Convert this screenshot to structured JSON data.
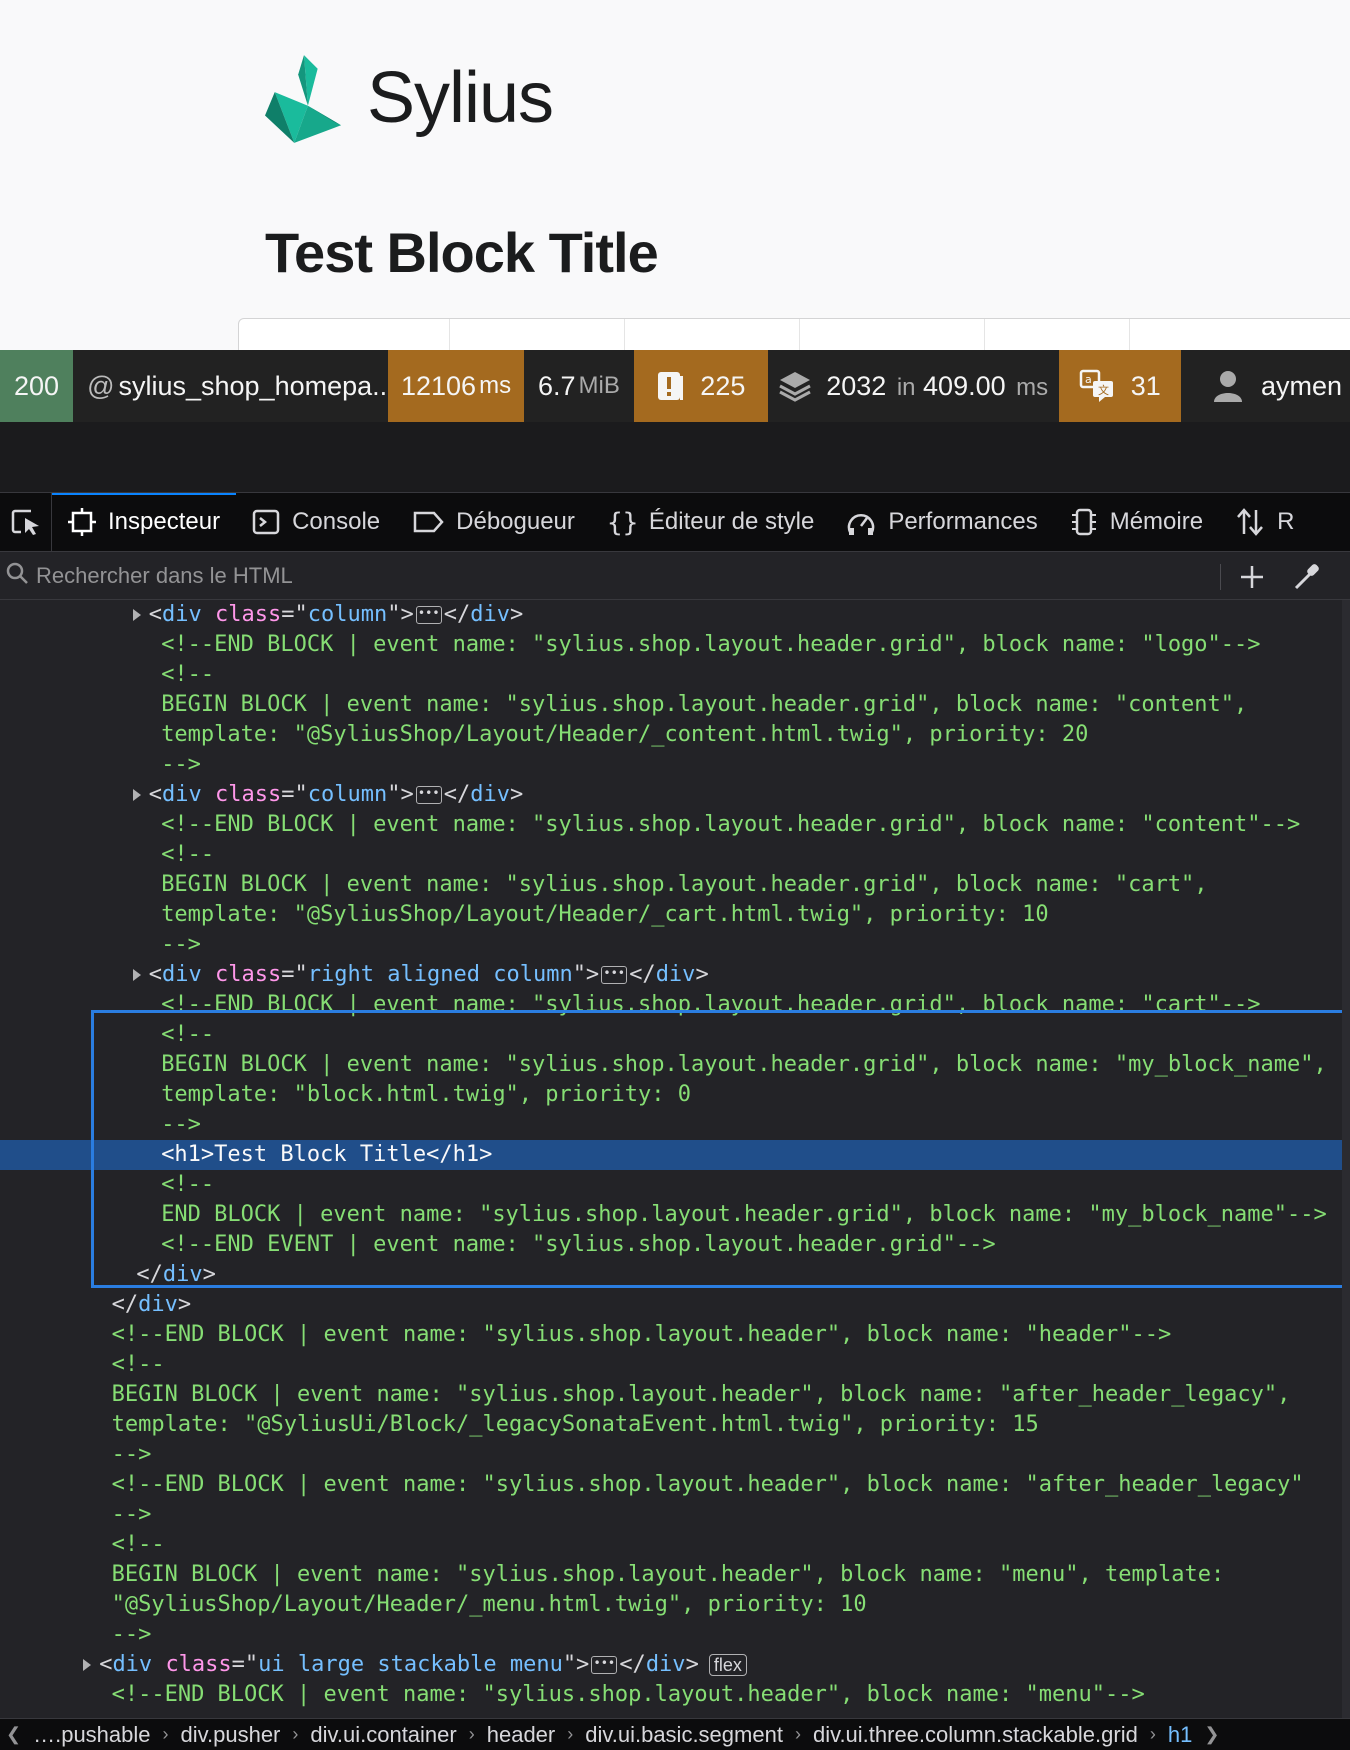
{
  "preview": {
    "logo_text": "Sylius",
    "heading": "Test Block Title"
  },
  "toolbar": {
    "status": "200",
    "route_at": "@",
    "route": "sylius_shop_homepa...",
    "time_value": "12106",
    "time_unit": "ms",
    "memory_value": "6.7",
    "memory_unit": "MiB",
    "forms_count": "225",
    "db_queries": "2032",
    "db_in": "in",
    "db_time": "409.00",
    "db_time_unit": "ms",
    "translations_count": "31",
    "user": "aymen"
  },
  "devtools": {
    "tabs": [
      {
        "label": "Inspecteur",
        "icon": "inspector-icon",
        "active": true
      },
      {
        "label": "Console",
        "icon": "console-icon"
      },
      {
        "label": "Débogueur",
        "icon": "debugger-icon"
      },
      {
        "label": "Éditeur de style",
        "icon": "style-editor-icon"
      },
      {
        "label": "Performances",
        "icon": "performance-icon"
      },
      {
        "label": "Mémoire",
        "icon": "memory-icon"
      },
      {
        "label": "R",
        "icon": "network-icon"
      }
    ],
    "search_placeholder": "Rechercher dans le HTML"
  },
  "markup": {
    "lines": [
      {
        "type": "el",
        "indent": 12,
        "expand": true,
        "tag": "div",
        "attrs": [
          [
            "class",
            "column"
          ]
        ],
        "collapsed": true
      },
      {
        "type": "c",
        "indent": 13,
        "text": "<!--END BLOCK | event name: \"sylius.shop.layout.header.grid\", block name: \"logo\"-->"
      },
      {
        "type": "c",
        "indent": 13,
        "text": "<!--"
      },
      {
        "type": "c",
        "indent": 13,
        "text": "BEGIN BLOCK | event name: \"sylius.shop.layout.header.grid\", block name: \"content\","
      },
      {
        "type": "c",
        "indent": 13,
        "text": "template: \"@SyliusShop/Layout/Header/_content.html.twig\", priority: 20"
      },
      {
        "type": "c",
        "indent": 13,
        "text": "-->"
      },
      {
        "type": "el",
        "indent": 12,
        "expand": true,
        "tag": "div",
        "attrs": [
          [
            "class",
            "column"
          ]
        ],
        "collapsed": true
      },
      {
        "type": "c",
        "indent": 13,
        "text": "<!--END BLOCK | event name: \"sylius.shop.layout.header.grid\", block name: \"content\"-->"
      },
      {
        "type": "c",
        "indent": 13,
        "text": "<!--"
      },
      {
        "type": "c",
        "indent": 13,
        "text": "BEGIN BLOCK | event name: \"sylius.shop.layout.header.grid\", block name: \"cart\","
      },
      {
        "type": "c",
        "indent": 13,
        "text": "template: \"@SyliusShop/Layout/Header/_cart.html.twig\", priority: 10"
      },
      {
        "type": "c",
        "indent": 13,
        "text": "-->"
      },
      {
        "type": "el",
        "indent": 12,
        "expand": true,
        "tag": "div",
        "attrs": [
          [
            "class",
            "right aligned column"
          ]
        ],
        "collapsed": true
      },
      {
        "type": "c",
        "indent": 13,
        "text": "<!--END BLOCK | event name: \"sylius.shop.layout.header.grid\", block name: \"cart\"-->"
      },
      {
        "type": "c",
        "indent": 13,
        "text": "<!--"
      },
      {
        "type": "c",
        "indent": 13,
        "text": "BEGIN BLOCK | event name: \"sylius.shop.layout.header.grid\", block name: \"my_block_name\","
      },
      {
        "type": "c",
        "indent": 13,
        "text": "template: \"block.html.twig\", priority: 0"
      },
      {
        "type": "c",
        "indent": 13,
        "text": "-->"
      },
      {
        "type": "sel",
        "indent": 13,
        "open": "<h1>",
        "text": "Test Block Title",
        "close": "</h1>"
      },
      {
        "type": "c",
        "indent": 13,
        "text": "<!--"
      },
      {
        "type": "c",
        "indent": 13,
        "text": "END BLOCK | event name: \"sylius.shop.layout.header.grid\", block name: \"my_block_name\"-->"
      },
      {
        "type": "c",
        "indent": 13,
        "text": "<!--END EVENT | event name: \"sylius.shop.layout.header.grid\"-->"
      },
      {
        "type": "close",
        "indent": 11,
        "tag": "div"
      },
      {
        "type": "close",
        "indent": 9,
        "tag": "div"
      },
      {
        "type": "c",
        "indent": 9,
        "text": "<!--END BLOCK | event name: \"sylius.shop.layout.header\", block name: \"header\"-->"
      },
      {
        "type": "c",
        "indent": 9,
        "text": "<!--"
      },
      {
        "type": "c",
        "indent": 9,
        "text": "BEGIN BLOCK | event name: \"sylius.shop.layout.header\", block name: \"after_header_legacy\","
      },
      {
        "type": "c",
        "indent": 9,
        "text": "template: \"@SyliusUi/Block/_legacySonataEvent.html.twig\", priority: 15"
      },
      {
        "type": "c",
        "indent": 9,
        "text": "-->"
      },
      {
        "type": "c",
        "indent": 9,
        "text": "<!--END BLOCK | event name: \"sylius.shop.layout.header\", block name: \"after_header_legacy\""
      },
      {
        "type": "c",
        "indent": 9,
        "text": "-->"
      },
      {
        "type": "c",
        "indent": 9,
        "text": "<!--"
      },
      {
        "type": "c",
        "indent": 9,
        "text": "BEGIN BLOCK | event name: \"sylius.shop.layout.header\", block name: \"menu\", template:"
      },
      {
        "type": "c",
        "indent": 9,
        "text": "\"@SyliusShop/Layout/Header/_menu.html.twig\", priority: 10"
      },
      {
        "type": "c",
        "indent": 9,
        "text": "-->"
      },
      {
        "type": "el",
        "indent": 8,
        "expand": true,
        "tag": "div",
        "attrs": [
          [
            "class",
            "ui large stackable menu"
          ]
        ],
        "collapsed": true,
        "badge": "flex"
      },
      {
        "type": "c",
        "indent": 9,
        "text": "<!--END BLOCK | event name: \"sylius.shop.layout.header\", block name: \"menu\"-->"
      }
    ]
  },
  "breadcrumbs": [
    "….pushable",
    "div.pusher",
    "div.ui.container",
    "header",
    "div.ui.basic.segment",
    "div.ui.three.column.stackable.grid",
    "h1"
  ],
  "colors": {
    "status_ok": "#4f805d",
    "warning": "#a46a1f",
    "sylius_teal": "#1abb9c",
    "selection": "#204e8a",
    "highlight_border": "#2a7de1",
    "comment": "#86de74",
    "tag": "#75bfff",
    "attr": "#ff97ea"
  }
}
